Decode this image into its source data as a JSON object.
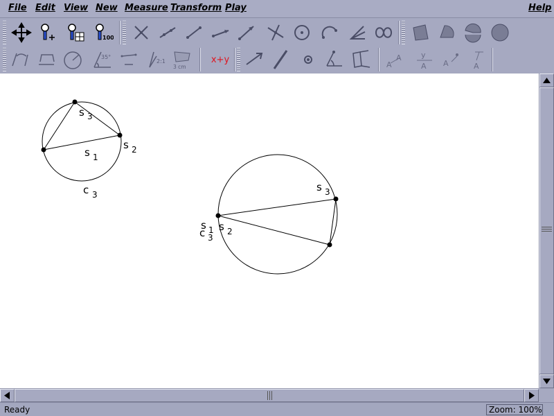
{
  "menu": {
    "file": "File",
    "edit": "Edit",
    "view": "View",
    "new": "New",
    "measure": "Measure",
    "transform": "Transform",
    "play": "Play",
    "help": "Help"
  },
  "toolbar": {
    "zoom100_label": "100%",
    "calc_label": "x+y",
    "area_unit_label": "3 cm",
    "ratio_label": "2:1",
    "angle_label": "35°"
  },
  "canvas": {
    "figure1": {
      "circle_label": "c",
      "circle_sub": "3",
      "segments": [
        {
          "name": "s",
          "sub": "1"
        },
        {
          "name": "s",
          "sub": "2"
        },
        {
          "name": "s",
          "sub": "3"
        }
      ]
    },
    "figure2": {
      "circle_label": "c",
      "circle_sub": "3",
      "segments": [
        {
          "name": "s",
          "sub": "1"
        },
        {
          "name": "s",
          "sub": "2"
        },
        {
          "name": "s",
          "sub": "3"
        }
      ]
    }
  },
  "status": {
    "text": "Ready",
    "zoom": "Zoom: 100%"
  }
}
